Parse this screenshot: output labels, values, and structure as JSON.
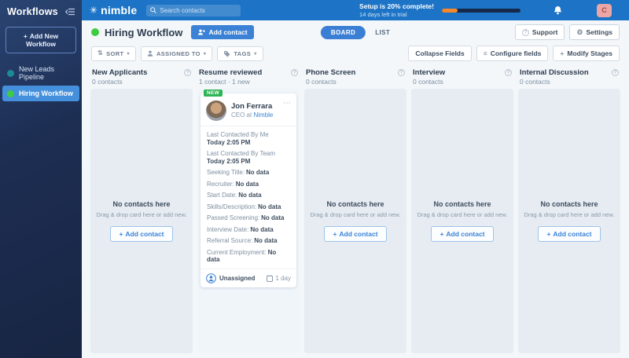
{
  "sidebar": {
    "title": "Workflows",
    "add_workflow_label": "Add New Workflow",
    "items": [
      {
        "label": "New Leads Pipeline",
        "dot_color": "#1b8a97",
        "selected": false
      },
      {
        "label": "Hiring Workflow",
        "dot_color": "#3ecb40",
        "selected": true
      }
    ]
  },
  "topbar": {
    "brand": "nimble",
    "search_placeholder": "Search contacts",
    "setup_title": "Setup is 20% complete!",
    "setup_subtitle": "14 days left in trial",
    "progress_percent": 20,
    "avatar_initial": "C"
  },
  "subheader": {
    "title": "Hiring Workflow",
    "add_contact_label": "Add contact",
    "board_label": "BOARD",
    "list_label": "LIST",
    "support_label": "Support",
    "settings_label": "Settings"
  },
  "filterbar": {
    "sort": "SORT",
    "assigned_to": "ASSIGNED TO",
    "tags": "TAGS",
    "collapse_fields": "Collapse Fields",
    "configure_fields": "Configure fields",
    "modify_stages": "Modify Stages"
  },
  "board": {
    "columns": [
      {
        "name": "New Applicants",
        "count": "0 contacts"
      },
      {
        "name": "Resume reviewed",
        "count": "1 contact · 1 new"
      },
      {
        "name": "Phone Screen",
        "count": "0 contacts"
      },
      {
        "name": "Interview",
        "count": "0 contacts"
      },
      {
        "name": "Internal Discussion",
        "count": "0 contacts"
      }
    ],
    "empty": {
      "title": "No contacts here",
      "subtitle": "Drag & drop card here or add new.",
      "add_label": "Add contact"
    }
  },
  "card": {
    "badge": "NEW",
    "name": "Jon Ferrara",
    "title_prefix": "CEO at ",
    "title_link": "Nimble",
    "fields": [
      {
        "label": "Last Contacted By Me",
        "value": "Today 2:05 PM"
      },
      {
        "label": "Last Contacted By Team",
        "value": "Today 2:05 PM"
      },
      {
        "label": "Seeking Title:",
        "value": "No data"
      },
      {
        "label": "Recruiter:",
        "value": "No data"
      },
      {
        "label": "Start Date:",
        "value": "No data"
      },
      {
        "label": "Skills/Description:",
        "value": "No data"
      },
      {
        "label": "Passed Screening:",
        "value": "No data"
      },
      {
        "label": "Interview Date:",
        "value": "No data"
      },
      {
        "label": "Referral Source:",
        "value": "No data"
      },
      {
        "label": "Current Employment:",
        "value": "No data"
      }
    ],
    "footer": {
      "assignee": "Unassigned",
      "age": "1 day"
    }
  },
  "icons": {
    "plus": "+",
    "caret_down": "▾",
    "sort_arrows": "⇅",
    "ellipsis": "⋯",
    "gear": "⚙",
    "question": "?",
    "brand_mark": "✳",
    "configure_lines": "≡"
  },
  "colors": {
    "accent_blue": "#3b82d6",
    "topbar_blue": "#1d74c6",
    "sidebar_navy": "#1d2e53",
    "selected_blue": "#4590dc",
    "status_green": "#3ecb40",
    "teal": "#1b8a97",
    "progress_orange": "#f6872b",
    "badge_green": "#2eb553",
    "avatar_pink": "#eca6a6",
    "column_bg": "#e6ecf2",
    "board_bg": "#f3f7fa"
  }
}
